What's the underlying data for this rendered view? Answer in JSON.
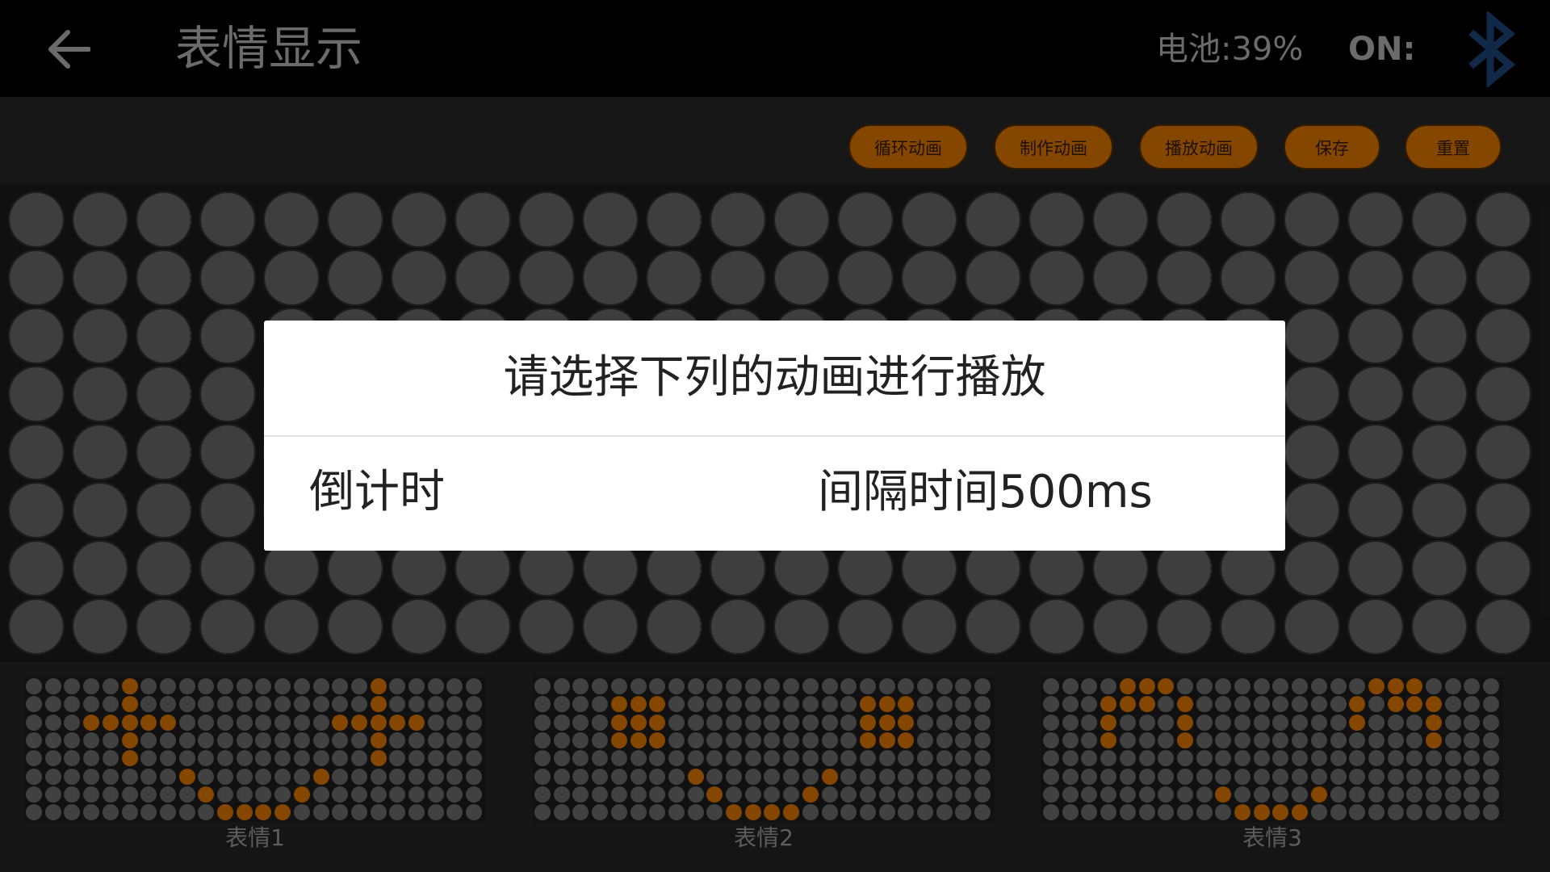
{
  "header": {
    "title": "表情显示",
    "battery": "电池:39%",
    "connection": "ON:",
    "icons": {
      "back": "back-arrow-icon",
      "bluetooth": "bluetooth-icon"
    }
  },
  "toolbar": {
    "loop_label": "循环动画",
    "make_label": "制作动画",
    "play_label": "播放动画",
    "save_label": "保存",
    "reset_label": "重置",
    "button_color": "#c46800"
  },
  "grid": {
    "rows": 8,
    "cols": 24
  },
  "dialog": {
    "title": "请选择下列的动画进行播放",
    "item_name": "倒计时",
    "item_interval": "间隔时间500ms"
  },
  "thumbnails": [
    {
      "label": "表情1"
    },
    {
      "label": "表情2"
    },
    {
      "label": "表情3"
    }
  ],
  "colors": {
    "accent": "#c46800",
    "led_off": "#5c5c5c",
    "header_bg": "#000000"
  }
}
